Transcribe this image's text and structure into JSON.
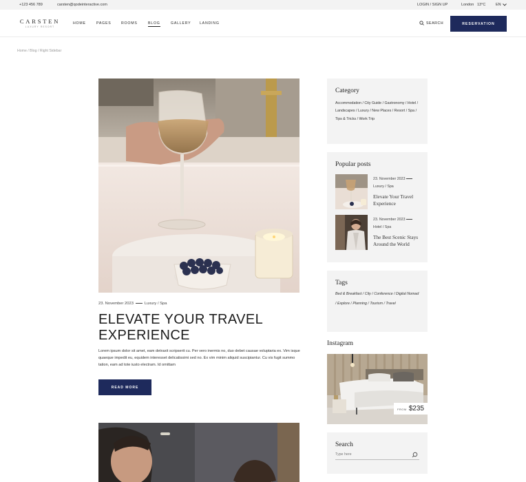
{
  "topbar": {
    "phone": "+123 456 789",
    "email": "carsten@qodeinteractive.com",
    "login": "LOGIN / SIGN UP",
    "city": "London",
    "temp": "13°C",
    "lang": "EN"
  },
  "header": {
    "logo_name": "CARSTEN",
    "logo_sub": "LUXURY RESORT",
    "nav": [
      "HOME",
      "PAGES",
      "ROOMS",
      "BLOG",
      "GALLERY",
      "LANDING"
    ],
    "search_label": "SEARCH",
    "reservation_label": "RESERVATION"
  },
  "breadcrumb": "Home / Blog / Right Sidebar",
  "post": {
    "date": "23. November 2023",
    "categories": "Luxury / Spa",
    "title_line1": "ELEVATE YOUR TRAVEL",
    "title_line2": "EXPERIENCE",
    "excerpt": "Lorem ipsum dolor sit amet, eam detraxit scripserit cu. Per vero inermis no, duo debet causae voluptaria ex. Vim isque quaeque impedit eu, equidem interesset delicatissimi sed no. Ex vim minim aliquid suscipiantur. Cu vis fugit summo tation, eam ad tote iusto electram. Id omittam",
    "read_more": "READ MORE"
  },
  "sidebar": {
    "category_title": "Category",
    "categories": "Accommodation / City Guide / Gastronomy / Hotel / Landscapes / Luxury / New Places / Resort / Spa / Tips & Tricks / Work Trip",
    "popular_title": "Popular posts",
    "popular": [
      {
        "date": "23. November 2023",
        "cats": "Luxury / Spa",
        "title": "Elevate Your Travel Experience"
      },
      {
        "date": "23. November 2023",
        "cats": "Hotel / Spa",
        "title": "The Best Scenic Stays Around the World"
      }
    ],
    "tags_title": "Tags",
    "tags": "Bed & Breakfast / City / Conference / Digital Nomad / Explore / Planning / Tourism / Travel",
    "instagram_title": "Instagram",
    "price_from": "FROM",
    "price_value": "$235",
    "search_title": "Search",
    "search_placeholder": "Type here"
  },
  "colors": {
    "accent": "#1e2a5c",
    "widget_bg": "#f3f3f3"
  }
}
